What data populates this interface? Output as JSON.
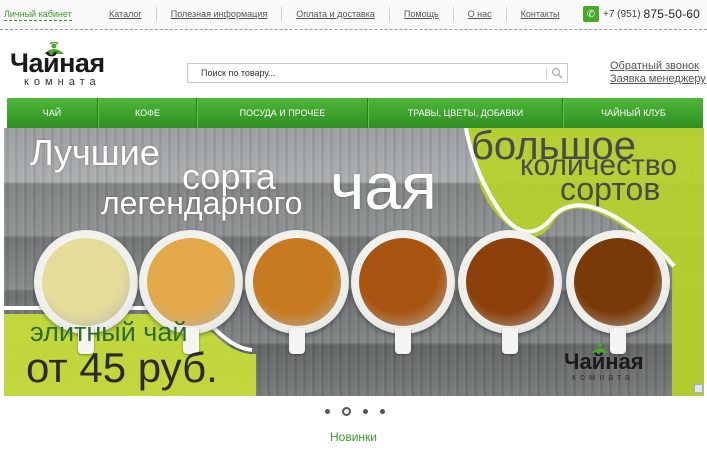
{
  "topbar": {
    "cabinet_label": "Личный кабинет",
    "nav": [
      "Каталог",
      "Полезная информация",
      "Оплата и доставка",
      "Помощь",
      "О нас",
      "Контакты"
    ],
    "phone_prefix": "+7 (951)",
    "phone_number": "875-50-60",
    "phone_icon": "phone-icon"
  },
  "header": {
    "logo_title": "Чайная",
    "logo_subtitle": "комната",
    "search_placeholder": "Поиск по товару...",
    "search_icon": "search-icon",
    "callback_label": "Обратный звонок",
    "manager_label": "Заявка менеджеру"
  },
  "menu": {
    "items": [
      "ЧАЙ",
      "КОФЕ",
      "ПОСУДА И ПРОЧЕЕ",
      "ТРАВЫ, ЦВЕТЫ, ДОБАВКИ",
      "ЧАЙНЫЙ КЛУБ"
    ]
  },
  "banner": {
    "line1": "Лучшие",
    "line2": "сорта",
    "line3": "легендарного",
    "line4": "чая",
    "right1": "большое",
    "right2": "количество",
    "right3": "сортов",
    "elite": "элитный чай",
    "price": "от 45 руб.",
    "logo_title": "Чайная",
    "logo_subtitle": "комната",
    "tea_colors": [
      "#e6dc9a",
      "#e2a84a",
      "#c77a1f",
      "#a85512",
      "#8c3f0a",
      "#7a3a08"
    ]
  },
  "slider": {
    "dot_count": 4,
    "active_index": 1
  },
  "section": {
    "title": "Новинки"
  },
  "colors": {
    "accent": "#3c9a2b",
    "menu": "#3ea22c",
    "lime": "#b6d22a"
  }
}
